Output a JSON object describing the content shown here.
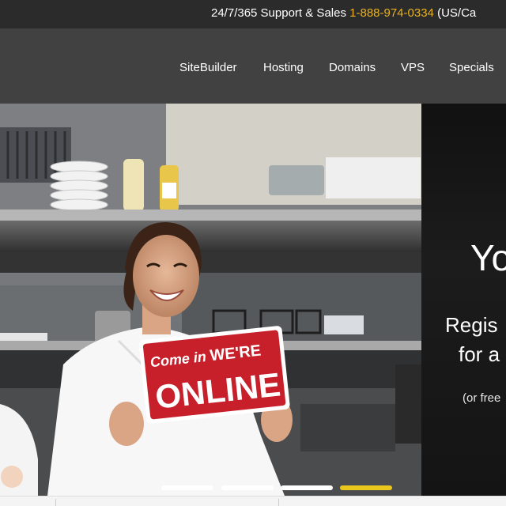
{
  "topbar": {
    "support_text": "24/7/365 Support & Sales",
    "phone": "1-888-974-0334",
    "region": "(US/Ca"
  },
  "nav": {
    "items": [
      {
        "label": "SiteBuilder"
      },
      {
        "label": "Hosting"
      },
      {
        "label": "Domains"
      },
      {
        "label": "VPS"
      },
      {
        "label": "Specials"
      }
    ]
  },
  "hero": {
    "headline": "Yo",
    "line1": "Regis",
    "line2": "for a",
    "line3": "(or free",
    "sign": {
      "script_text": "Come in",
      "text_top": "WE'RE",
      "text_main": "ONLINE"
    }
  },
  "slider": {
    "slide_count": 4,
    "active_index": 3
  },
  "colors": {
    "topbar_bg": "#2b2b2b",
    "navbar_bg": "#414141",
    "phone_accent": "#e9b21c",
    "active_dot": "#e9c71c",
    "sign_red": "#c8202b"
  }
}
